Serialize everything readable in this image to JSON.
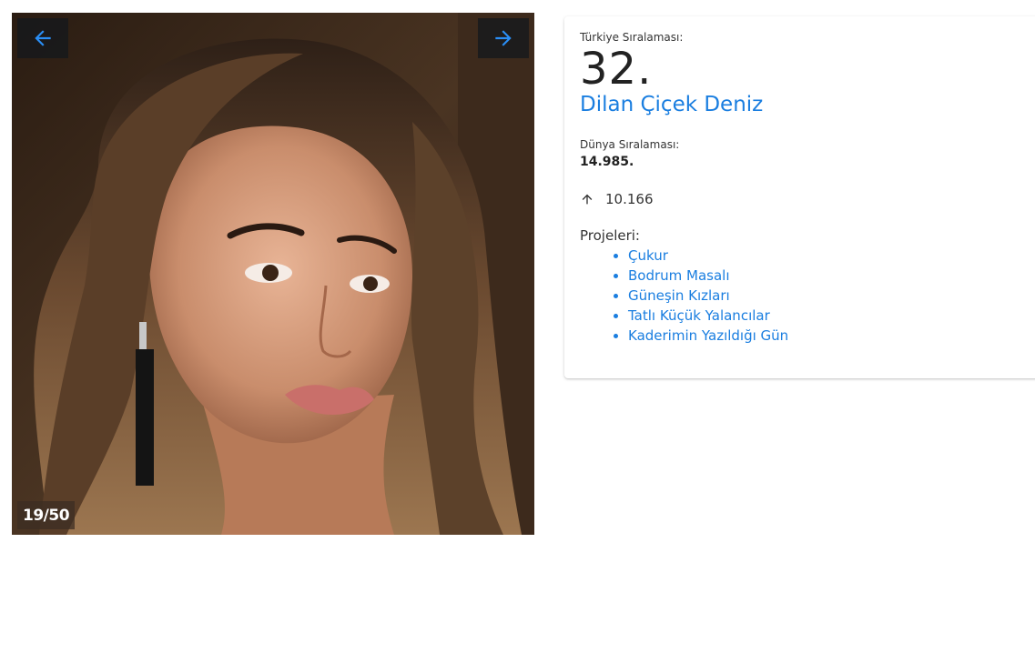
{
  "gallery": {
    "counter": "19/50",
    "prev_icon": "arrow-left-icon",
    "next_icon": "arrow-right-icon",
    "current_index": 19,
    "total": 50
  },
  "profile": {
    "turkey_rank_label": "Türkiye Sıralaması:",
    "turkey_rank_value": "32.",
    "name": "Dilan Çiçek Deniz",
    "world_rank_label": "Dünya Sıralaması:",
    "world_rank_value": "14.985.",
    "trend_icon": "arrow-up-icon",
    "trend_value": "10.166",
    "projects_label": "Projeleri:",
    "projects": [
      "Çukur",
      "Bodrum Masalı",
      "Güneşin Kızları",
      "Tatlı Küçük Yalancılar",
      "Kaderimin Yazıldığı Gün"
    ]
  },
  "colors": {
    "accent": "#1a7ee0",
    "nav_button_bg": "#14181c",
    "text": "#222222"
  }
}
